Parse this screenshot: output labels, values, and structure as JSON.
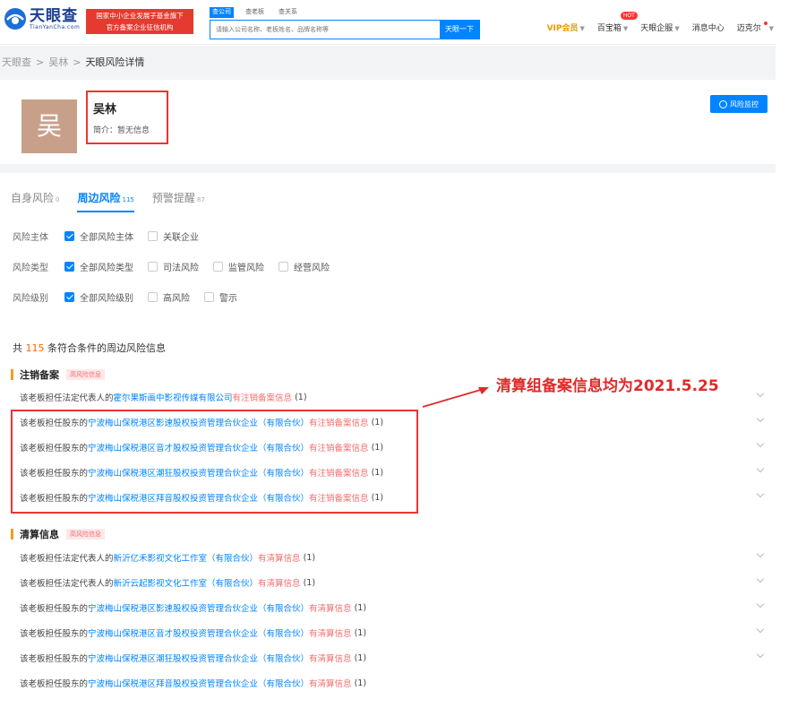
{
  "header": {
    "logo_main": "天眼查",
    "logo_sub": "TianYanCha.com",
    "promo_line1": "国家中小企业发展子基金旗下",
    "promo_line2": "官方备案企业征信机构",
    "search_tabs": [
      "查公司",
      "查老板",
      "查关系"
    ],
    "search_placeholder": "请输入公司名称、老板姓名、品牌名称等",
    "search_button": "天眼一下",
    "nav": {
      "vip": "VIP会员",
      "treasure": "百宝箱",
      "hot": "HOT",
      "enterprise": "天眼企服",
      "messages": "消息中心",
      "user": "迈克尔"
    }
  },
  "breadcrumb": [
    "天眼查",
    "吴林",
    "天眼风险详情"
  ],
  "profile": {
    "avatar_char": "吴",
    "name": "吴林",
    "intro": "简介：暂无信息",
    "monitor_button": "风险监控"
  },
  "tabs": [
    {
      "label": "自身风险",
      "count": "0"
    },
    {
      "label": "周边风险",
      "count": "115"
    },
    {
      "label": "预警提醒",
      "count": "87"
    }
  ],
  "filters": [
    {
      "label": "风险主体",
      "options": [
        {
          "text": "全部风险主体",
          "checked": true
        },
        {
          "text": "关联企业",
          "checked": false
        }
      ]
    },
    {
      "label": "风险类型",
      "options": [
        {
          "text": "全部风险类型",
          "checked": true
        },
        {
          "text": "司法风险",
          "checked": false
        },
        {
          "text": "监管风险",
          "checked": false
        },
        {
          "text": "经营风险",
          "checked": false
        }
      ]
    },
    {
      "label": "风险级别",
      "options": [
        {
          "text": "全部风险级别",
          "checked": true
        },
        {
          "text": "高风险",
          "checked": false
        },
        {
          "text": "警示",
          "checked": false
        }
      ]
    }
  ],
  "summary": {
    "prefix": "共",
    "count": "115",
    "suffix": "条符合条件的周边风险信息"
  },
  "sections": [
    {
      "title": "注销备案",
      "tag": "高风险信息",
      "rows": [
        {
          "prefix": "该老板担任法定代表人的",
          "company": "霍尔果斯画中影视传媒有限公司",
          "risk": "有注销备案信息",
          "count": "(1)"
        },
        {
          "prefix": "该老板担任股东的",
          "company": "宁波梅山保税港区影速股权投资管理合伙企业（有限合伙）",
          "risk": "有注销备案信息",
          "count": "(1)"
        },
        {
          "prefix": "该老板担任股东的",
          "company": "宁波梅山保税港区音才股权投资管理合伙企业（有限合伙）",
          "risk": "有注销备案信息",
          "count": "(1)"
        },
        {
          "prefix": "该老板担任股东的",
          "company": "宁波梅山保税港区潮狂股权投资管理合伙企业（有限合伙）",
          "risk": "有注销备案信息",
          "count": "(1)"
        },
        {
          "prefix": "该老板担任股东的",
          "company": "宁波梅山保税港区拜音股权投资管理合伙企业（有限合伙）",
          "risk": "有注销备案信息",
          "count": "(1)"
        }
      ]
    },
    {
      "title": "清算信息",
      "tag": "高风险信息",
      "rows": [
        {
          "prefix": "该老板担任法定代表人的",
          "company": "新沂亿禾影视文化工作室（有限合伙）",
          "risk": "有清算信息",
          "count": "(1)"
        },
        {
          "prefix": "该老板担任法定代表人的",
          "company": "新沂云起影视文化工作室（有限合伙）",
          "risk": "有清算信息",
          "count": "(1)"
        },
        {
          "prefix": "该老板担任股东的",
          "company": "宁波梅山保税港区影速股权投资管理合伙企业（有限合伙）",
          "risk": "有清算信息",
          "count": "(1)"
        },
        {
          "prefix": "该老板担任股东的",
          "company": "宁波梅山保税港区音才股权投资管理合伙企业（有限合伙）",
          "risk": "有清算信息",
          "count": "(1)"
        },
        {
          "prefix": "该老板担任股东的",
          "company": "宁波梅山保税港区潮狂股权投资管理合伙企业（有限合伙）",
          "risk": "有清算信息",
          "count": "(1)"
        },
        {
          "prefix": "该老板担任股东的",
          "company": "宁波梅山保税港区拜音股权投资管理合伙企业（有限合伙）",
          "risk": "有清算信息",
          "count": "(1)"
        }
      ]
    }
  ],
  "annotation": "清算组备案信息均为2021.5.25",
  "colors": {
    "brand_blue": "#0084ff",
    "risk_red": "#f56c6c",
    "annotation_red": "#e02a2a"
  }
}
